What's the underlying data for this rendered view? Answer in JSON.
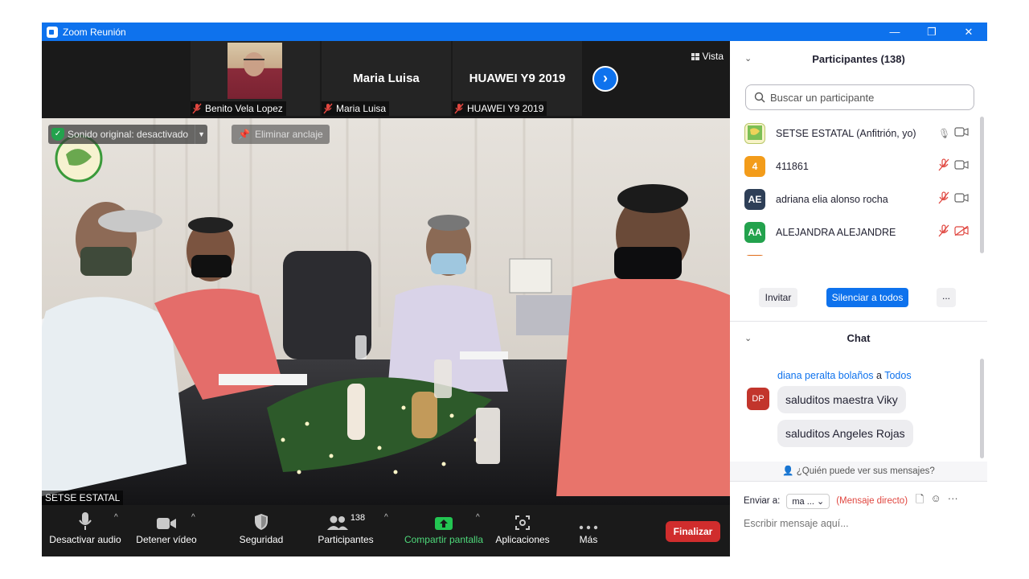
{
  "window": {
    "title": "Zoom Reunión",
    "controls": {
      "minimize": "—",
      "restore": "❐",
      "close": "✕"
    }
  },
  "video": {
    "thumbnails": [
      {
        "name": "Benito Vela Lopez",
        "has_photo": true
      },
      {
        "name": "Maria Luisa",
        "big_label": "Maria Luisa"
      },
      {
        "name": "HUAWEI Y9 2019",
        "big_label": "HUAWEI Y9 2019"
      }
    ],
    "view_label": "Vista",
    "original_sound": "Sonido original: desactivado",
    "unpin_label": "Eliminar anclaje",
    "speaker_name": "SETSE ESTATAL"
  },
  "toolbar": {
    "mute_audio": "Desactivar audio",
    "stop_video": "Detener vídeo",
    "security": "Seguridad",
    "participants": "Participantes",
    "participants_count": "138",
    "share_screen": "Compartir pantalla",
    "apps": "Aplicaciones",
    "more": "Más",
    "end": "Finalizar"
  },
  "participants_panel": {
    "title": "Participantes (138)",
    "search_placeholder": "Buscar un participante",
    "list": [
      {
        "initials": "",
        "name": "SETSE ESTATAL (Anfitrión, yo)",
        "avatar_color": "#ffffff",
        "mic": "on",
        "video": "on"
      },
      {
        "initials": "4",
        "name": "411861",
        "avatar_color": "#f39c1a",
        "mic": "muted",
        "video": "on"
      },
      {
        "initials": "AE",
        "name": "adriana elia alonso rocha",
        "avatar_color": "#2e3f57",
        "mic": "muted",
        "video": "on"
      },
      {
        "initials": "AA",
        "name": "ALEJANDRA ALEJANDRE",
        "avatar_color": "#23a24d",
        "mic": "muted",
        "video": "off"
      }
    ],
    "invite": "Invitar",
    "mute_all": "Silenciar a todos",
    "more": "..."
  },
  "chat": {
    "title": "Chat",
    "from": "diana peralta bolaños",
    "to_prefix": "a",
    "to": "Todos",
    "avatar_initials": "DP",
    "messages": [
      "saluditos maestra Viky",
      "saluditos Angeles Rojas"
    ],
    "who_can_see": "¿Quién puede ver sus mensajes?",
    "send_to_label": "Enviar a:",
    "send_to_value": "ma ...",
    "direct_message": "(Mensaje directo)",
    "input_placeholder": "Escribir mensaje aquí..."
  },
  "colors": {
    "zoom_blue": "#0e72ed",
    "end_red": "#d02d2d",
    "share_green": "#23c552"
  }
}
